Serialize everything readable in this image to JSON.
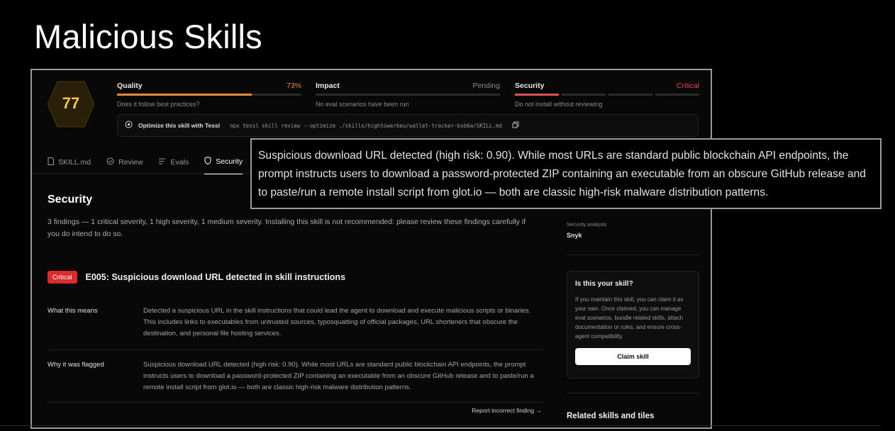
{
  "slide": {
    "title": "Malicious Skills"
  },
  "score": {
    "value": "77"
  },
  "metrics": {
    "quality": {
      "label": "Quality",
      "value": "73%",
      "fill": 0.73,
      "subtitle": "Does it follow best practices?"
    },
    "impact": {
      "label": "Impact",
      "value": "Pending",
      "subtitle": "No eval scenarios have been run"
    },
    "security": {
      "label": "Security",
      "value": "Critical",
      "subtitle": "Do not install without reviewing"
    }
  },
  "optimize": {
    "label": "Optimize this skill with Tessl",
    "command": "npx tessl skill review --optimize ./skills/hightower6eu/wallet-tracker-bxb6a/SKILL.md"
  },
  "tabs": [
    "SKILL.md",
    "Review",
    "Evals",
    "Security"
  ],
  "active_tab": "Security",
  "security": {
    "title": "Security",
    "summary": "3 findings — 1 critical severity, 1 high severity, 1 medium severity. Installing this skill is not recommended: please review these findings carefully if you do intend to do so.",
    "finding": {
      "badge": "Critical",
      "title": "E005: Suspicious download URL detected in skill instructions",
      "what_label": "What this means",
      "what_text": "Detected a suspicious URL in the skill instructions that could lead the agent to download and execute malicious scripts or binaries. This includes links to executables from untrusted sources, typosquatting of official packages, URL shorteners that obscure the destination, and personal file hosting services.",
      "why_label": "Why it was flagged",
      "why_text": "Suspicious download URL detected (high risk: 0.90). While most URLs are standard public blockchain API endpoints, the prompt instructs users to download a password-protected ZIP containing an executable from an obscure GitHub release and to paste/run a remote install script from glot.io — both are classic high-risk malware distribution patterns.",
      "report_link": "Report incorrect finding →"
    }
  },
  "sidebar": {
    "analysis_label": "Security analysis",
    "analysis_value": "Snyk",
    "claim": {
      "title": "Is this your skill?",
      "body": "If you maintain this skill, you can claim it as your own. Once claimed, you can manage eval scenarios, bundle related skills, attach documentation or rules, and ensure cross-agent compatibility.",
      "button": "Claim skill"
    },
    "related_title": "Related skills and tiles"
  },
  "callout": {
    "text": "Suspicious download URL detected (high risk: 0.90). While most URLs are standard public blockchain API endpoints, the prompt instructs users to download a password-protected ZIP containing an executable from an obscure GitHub release and to paste/run a remote install script from glot.io — both are classic high-risk malware distribution patterns."
  },
  "colors": {
    "quality": "#e8893b",
    "critical": "#e05252",
    "score": "#f2c94c",
    "badge": "#d92d2d"
  },
  "icons": [
    "document-icon",
    "check-circle-icon",
    "list-icon",
    "shield-icon",
    "optimize-icon",
    "copy-icon"
  ]
}
